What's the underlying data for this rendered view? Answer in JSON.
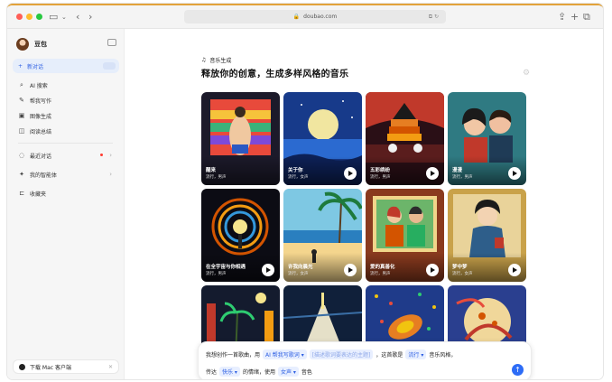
{
  "browser": {
    "url": "doubao.com"
  },
  "sidebar": {
    "brand": "豆包",
    "new_chat": "新对话",
    "items": [
      {
        "icon": "search-icon",
        "label": "AI 搜索"
      },
      {
        "icon": "pen-icon",
        "label": "帮我写作"
      },
      {
        "icon": "image-icon",
        "label": "图像生成"
      },
      {
        "icon": "book-icon",
        "label": "阅读总结"
      }
    ],
    "items2": [
      {
        "icon": "chat-icon",
        "label": "最近对话"
      },
      {
        "icon": "sparkle-icon",
        "label": "我的智能体"
      },
      {
        "icon": "bookmark-icon",
        "label": "收藏夹"
      }
    ],
    "download": "下载 Mac 客户端"
  },
  "main": {
    "section_label": "音乐生成",
    "headline": "释放你的创意，生成多样风格的音乐",
    "cards": [
      {
        "title": "醒来",
        "meta": "流行，男声"
      },
      {
        "title": "关于你",
        "meta": "流行，女声"
      },
      {
        "title": "五彩缤纷",
        "meta": "流行，男声"
      },
      {
        "title": "漫漫",
        "meta": "流行，男声"
      },
      {
        "title": "在全宇宙与你相遇",
        "meta": "流行，男声"
      },
      {
        "title": "许我向晨光",
        "meta": "流行，女声"
      },
      {
        "title": "爱的真善化",
        "meta": "流行，男声"
      },
      {
        "title": "梦中梦",
        "meta": "流行，女声"
      },
      {
        "title": "",
        "meta": ""
      },
      {
        "title": "",
        "meta": ""
      },
      {
        "title": "",
        "meta": ""
      },
      {
        "title": "",
        "meta": ""
      }
    ]
  },
  "composer": {
    "t1": "我想创作一首歌曲，用",
    "chip_ai": "AI 帮我写歌词 ▾",
    "chip_ph": "[描述歌词要表达的主题]",
    "t2": "，这首歌是",
    "chip_style": "流行 ▾",
    "t3": "音乐风格，",
    "t4": "传达",
    "chip_mood": "快乐 ▾",
    "t5": "的情绪，使用",
    "chip_voice": "女声 ▾",
    "t6": "音色"
  },
  "colors": {
    "accent": "#2d6cf6",
    "chip_bg": "#e8efff",
    "chip_text": "#2d5fe3"
  }
}
